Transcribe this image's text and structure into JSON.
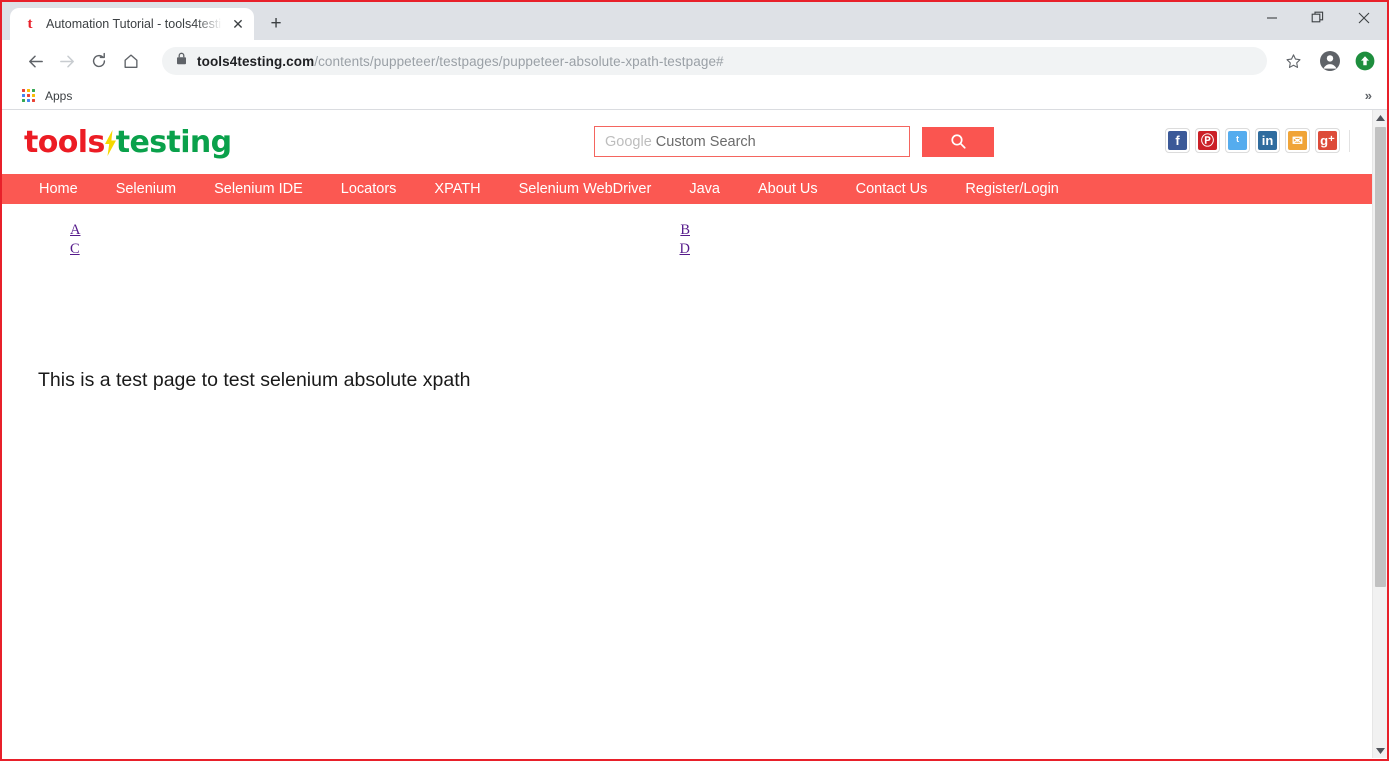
{
  "browser": {
    "tab": {
      "title": "Automation Tutorial - tools4testi",
      "favicon": "t",
      "close_label": "✕"
    },
    "newtab_label": "+",
    "window_controls": {
      "minimize": "minimize-icon",
      "restore": "restore-icon",
      "close": "close-icon"
    },
    "nav": {
      "back": "back-arrow-icon",
      "forward": "forward-arrow-icon",
      "reload": "reload-icon",
      "home": "home-icon"
    },
    "omnibox": {
      "lock": "lock-icon",
      "url_domain": "tools4testing.com",
      "url_path": "/contents/puppeteer/testpages/puppeteer-absolute-xpath-testpage#",
      "star": "star-icon",
      "profile": "profile-avatar-icon",
      "update": "update-icon"
    },
    "bookmarks": {
      "apps_label": "Apps",
      "apps_icon": "apps-grid-icon",
      "overflow_label": "»",
      "apps_colors": [
        "#ea4335",
        "#fbbc05",
        "#34a853",
        "#4285f4",
        "#ea4335",
        "#fbbc05",
        "#34a853",
        "#4285f4",
        "#ea4335"
      ]
    }
  },
  "site": {
    "logo": {
      "part1": "tools",
      "bolt": "lightning-bolt-4",
      "part2": "testing",
      "color_red": "#ec1c24",
      "color_green": "#0aa14b",
      "color_bolt": "#f5d800"
    },
    "search": {
      "brand": "Google",
      "placeholder": "Custom Search",
      "value": "",
      "button_icon": "search-icon",
      "button_color": "#fa5550"
    },
    "socials": [
      {
        "name": "facebook",
        "glyph": "f",
        "color": "#3b5998"
      },
      {
        "name": "pinterest",
        "glyph": "Ⓟ",
        "color": "#cb2027"
      },
      {
        "name": "twitter",
        "glyph": "ᵗ",
        "color": "#55acee"
      },
      {
        "name": "linkedin",
        "glyph": "in",
        "color": "#2f6c9e"
      },
      {
        "name": "email",
        "glyph": "✉",
        "color": "#f0a437"
      },
      {
        "name": "googleplus",
        "glyph": "g⁺",
        "color": "#dd4b39"
      }
    ],
    "nav_items": [
      "Home",
      "Selenium",
      "Selenium IDE",
      "Locators",
      "XPATH",
      "Selenium WebDriver",
      "Java",
      "About Us",
      "Contact Us",
      "Register/Login"
    ],
    "nav_color": "#fb5852",
    "links_table": [
      {
        "left": "A",
        "right": "B"
      },
      {
        "left": "C",
        "right": "D"
      }
    ],
    "body_text": "This is a test page to test selenium absolute xpath",
    "link_color": "#551a8b"
  },
  "scrollbar": {
    "up_arrow": "scroll-up-arrow-icon",
    "down_arrow": "scroll-down-arrow-icon"
  }
}
